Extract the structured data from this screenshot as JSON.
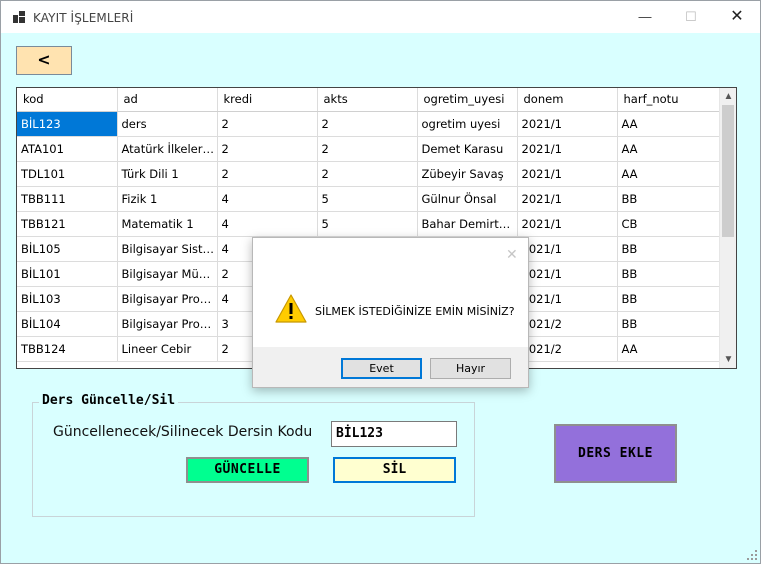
{
  "window": {
    "title": "KAYIT İŞLEMLERİ",
    "minimize_glyph": "—",
    "maximize_glyph": "☐",
    "close_glyph": "✕"
  },
  "back_button": {
    "label": "<"
  },
  "grid": {
    "columns": [
      "kod",
      "ad",
      "kredi",
      "akts",
      "ogretim_uyesi",
      "donem",
      "harf_notu"
    ],
    "rows": [
      [
        "BİL123",
        "ders",
        "2",
        "2",
        "ogretim uyesi",
        "2021/1",
        "AA"
      ],
      [
        "ATA101",
        "Atatürk İlkeleri ...",
        "2",
        "2",
        "Demet Karasu",
        "2021/1",
        "AA"
      ],
      [
        "TDL101",
        "Türk Dili 1",
        "2",
        "2",
        "Zübeyir Savaş",
        "2021/1",
        "AA"
      ],
      [
        "TBB111",
        "Fizik 1",
        "4",
        "5",
        "Gülnur Önsal",
        "2021/1",
        "BB"
      ],
      [
        "TBB121",
        "Matematik 1",
        "4",
        "5",
        "Bahar Demirtürk",
        "2021/1",
        "CB"
      ],
      [
        "BİL105",
        "Bilgisayar Siste...",
        "4",
        "",
        "",
        "2021/1",
        "BB"
      ],
      [
        "BİL101",
        "Bilgisayar Müh...",
        "2",
        "",
        "",
        "2021/1",
        "BB"
      ],
      [
        "BİL103",
        "Bilgisayar Progr...",
        "4",
        "",
        "",
        "2021/1",
        "BB"
      ],
      [
        "BİL104",
        "Bilgisayar Progr...",
        "3",
        "",
        "",
        "2021/2",
        "BB"
      ],
      [
        "TBB124",
        "Lineer Cebir",
        "2",
        "",
        "",
        "2021/2",
        "AA"
      ]
    ],
    "selected_cell": {
      "row": 0,
      "col": 0
    }
  },
  "edit_group": {
    "title": "Ders Güncelle/Sil",
    "code_label": "Güncellenecek/Silinecek Dersin Kodu",
    "code_value": "BİL123",
    "update_label": "GÜNCELLE",
    "delete_label": "SİL"
  },
  "add_button": {
    "label": "DERS EKLE"
  },
  "dialog": {
    "message": "SİLMEK İSTEDİĞİNİZE EMİN MİSİNİZ?",
    "yes_label": "Evet",
    "no_label": "Hayır",
    "close_glyph": "✕"
  },
  "colors": {
    "form_bg": "#d9ffff",
    "back_btn": "#ffe3b0",
    "update_btn": "#00ff90",
    "delete_btn": "#ffffd0",
    "add_btn": "#9370db",
    "selection": "#0078d7"
  }
}
